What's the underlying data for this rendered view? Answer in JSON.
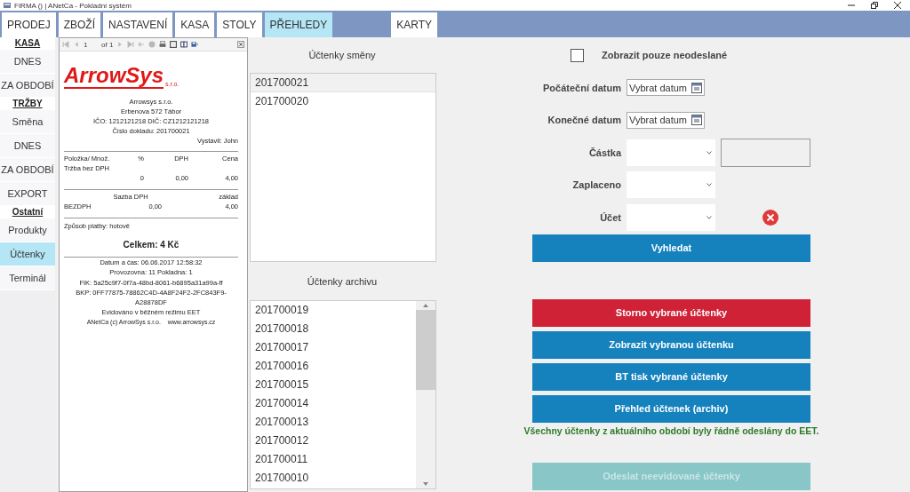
{
  "window": {
    "title": "FIRMA () | ANetCa - Pokladní systém"
  },
  "tabs": [
    {
      "label": "PRODEJ",
      "selected": false
    },
    {
      "label": "ZBOŽÍ",
      "selected": false
    },
    {
      "label": "NASTAVENÍ",
      "selected": false
    },
    {
      "label": "KASA",
      "selected": false
    },
    {
      "label": "STOLY",
      "selected": false
    },
    {
      "label": "PŘEHLEDY",
      "selected": true
    },
    {
      "label": "KARTY",
      "selected": false
    }
  ],
  "sidebar": {
    "items": [
      {
        "kind": "heading",
        "label": "KASA"
      },
      {
        "kind": "item",
        "label": "DNES",
        "selected": false
      },
      {
        "kind": "item",
        "label": "ZA OBDOBÍ",
        "selected": false
      },
      {
        "kind": "heading",
        "label": "TRŽBY"
      },
      {
        "kind": "item",
        "label": "Směna",
        "selected": false
      },
      {
        "kind": "item",
        "label": "DNES",
        "selected": false
      },
      {
        "kind": "item",
        "label": "ZA OBDOBÍ",
        "selected": false
      },
      {
        "kind": "item",
        "label": "EXPORT",
        "selected": false
      },
      {
        "kind": "heading",
        "label": "Ostatní"
      },
      {
        "kind": "item",
        "label": "Produkty",
        "selected": false
      },
      {
        "kind": "item",
        "label": "Účtenky",
        "selected": true
      },
      {
        "kind": "item",
        "label": "Terminál",
        "selected": false
      }
    ]
  },
  "report_viewer": {
    "toolbar": {
      "page": "1",
      "page_count": "of 1"
    },
    "receipt": {
      "logo": "ArrowSys",
      "logo_sub": "s.r.o.",
      "header_lines": [
        "Arrowsys s.r.o.",
        "Erbenova 572 Tábor",
        "IČO: 1212121218 DIČ: CZ1212121218",
        "Číslo dokladu: 201700021"
      ],
      "issued_by": "Vystavil: John",
      "items_table": {
        "columns": [
          "Položka/ Množ.",
          "%",
          "DPH",
          "Cena"
        ],
        "section": "Tržba bez DPH",
        "row": [
          "0",
          "0,00",
          "4,00"
        ]
      },
      "vat_table": {
        "columns": [
          "Sazba DPH",
          "základ"
        ],
        "row": [
          "BEZDPH",
          "0,00",
          "4,00"
        ]
      },
      "payment": "Způsob platby: hotově",
      "total": "Celkem: 4 Kč",
      "footer_lines": [
        "Datum a čas: 06.06.2017 12:58:32",
        "Provozovna: 11 Pokladna: 1",
        "FIK: 5a25c9f7-0f7a-48bd-8061-b6895a31a99a-ff",
        "BKP: 0FF77875-78862C4D-4A8F24F2-2FC843F9-A28878DF",
        "Evidováno v běžném režimu EET"
      ],
      "credits": "ANetCa (c) ArrowSys s.r.o.    www.arrowsys.cz"
    }
  },
  "shift_receipts": {
    "title": "Účtenky směny",
    "items": [
      {
        "label": "201700021",
        "selected": true
      },
      {
        "label": "201700020",
        "selected": false
      }
    ]
  },
  "archive_receipts": {
    "title": "Účtenky archivu",
    "items": [
      {
        "label": "201700019",
        "selected": false
      },
      {
        "label": "201700018",
        "selected": false
      },
      {
        "label": "201700017",
        "selected": false
      },
      {
        "label": "201700016",
        "selected": false
      },
      {
        "label": "201700015",
        "selected": false
      },
      {
        "label": "201700014",
        "selected": false
      },
      {
        "label": "201700013",
        "selected": false
      },
      {
        "label": "201700012",
        "selected": false
      },
      {
        "label": "201700011",
        "selected": false
      },
      {
        "label": "201700010",
        "selected": false
      }
    ]
  },
  "filters": {
    "show_unsent_only": {
      "label": "Zobrazit pouze neodeslané",
      "checked": false
    },
    "start_date": {
      "label": "Počáteční datum",
      "placeholder": "Vybrat datum"
    },
    "end_date": {
      "label": "Konečné datum",
      "placeholder": "Vybrat datum"
    },
    "amount": {
      "label": "Částka"
    },
    "paid": {
      "label": "Zaplaceno"
    },
    "account": {
      "label": "Účet"
    },
    "search_button": {
      "label": "Vyhledat"
    }
  },
  "actions": [
    {
      "kind": "danger",
      "label": "Storno vybrané účtenky"
    },
    {
      "kind": "primary",
      "label": "Zobrazit vybranou účtenku"
    },
    {
      "kind": "primary",
      "label": "BT tisk vybrané účtenky"
    },
    {
      "kind": "primary",
      "label": "Přehled účtenek (archiv)"
    },
    {
      "kind": "message",
      "label": "Všechny účtenky z aktuálního období byly řádně odeslány do EET."
    },
    {
      "kind": "disabled",
      "label": "Odeslat neevidované účtenky"
    }
  ]
}
